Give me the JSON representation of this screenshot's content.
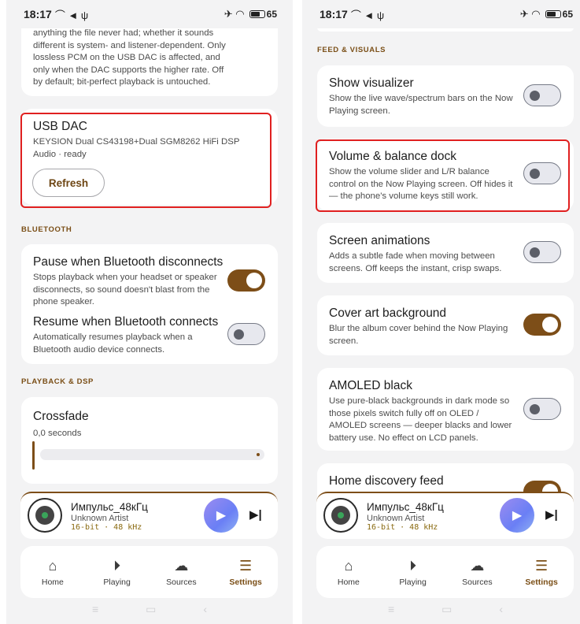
{
  "left": {
    "status": {
      "time": "18:17",
      "left_icons": "⌒ ◄ ψ",
      "right_icons": "✈ ◠",
      "battery": "65"
    },
    "top_card_text": "anything the file never had; whether it sounds different is system- and listener-dependent. Only lossless PCM on the USB DAC is affected, and only when the DAC supports the higher rate. Off by default; bit-perfect playback is untouched.",
    "usb_dac": {
      "title": "USB DAC",
      "desc": "KEYSION Dual CS43198+Dual SGM8262 HiFi DSP Audio · ready",
      "button": "Refresh"
    },
    "bluetooth_label": "BLUETOOTH",
    "bt_pause": {
      "title": "Pause when Bluetooth disconnects",
      "desc": "Stops playback when your headset or speaker disconnects, so sound doesn't blast from the phone speaker.",
      "on": true
    },
    "bt_resume": {
      "title": "Resume when Bluetooth connects",
      "desc": "Automatically resumes playback when a Bluetooth audio device connects.",
      "on": false
    },
    "playback_label": "PLAYBACK & DSP",
    "crossfade": {
      "title": "Crossfade",
      "value": "0,0 seconds"
    }
  },
  "right": {
    "status": {
      "time": "18:17",
      "left_icons": "⌒ ◄ ψ",
      "right_icons": "✈ ◠",
      "battery": "65"
    },
    "feed_label": "FEED & VISUALS",
    "visualizer": {
      "title": "Show visualizer",
      "desc": "Show the live wave/spectrum bars on the Now Playing screen.",
      "on": false
    },
    "volume_dock": {
      "title": "Volume & balance dock",
      "desc": "Show the volume slider and L/R balance control on the Now Playing screen. Off hides it — the phone's volume keys still work.",
      "on": false
    },
    "animations": {
      "title": "Screen animations",
      "desc": "Adds a subtle fade when moving between screens. Off keeps the instant, crisp swaps.",
      "on": false
    },
    "cover_bg": {
      "title": "Cover art background",
      "desc": "Blur the album cover behind the Now Playing screen.",
      "on": true
    },
    "amoled": {
      "title": "AMOLED black",
      "desc": "Use pure-black backgrounds in dark mode so those pixels switch fully off on OLED / AMOLED screens — deeper blacks and lower battery use. No effect on LCD panels.",
      "on": false
    },
    "home_feed": {
      "title": "Home discovery feed"
    }
  },
  "player": {
    "title": "Импульс_48кГц",
    "artist": "Unknown Artist",
    "quality": "16-bit · 48 kHz"
  },
  "nav": {
    "home": "Home",
    "playing": "Playing",
    "sources": "Sources",
    "settings": "Settings",
    "active": "settings"
  },
  "colors": {
    "accent": "#7d4e18",
    "highlight": "#e02020",
    "play_button": "#7f86f3"
  },
  "icons": {
    "home": "home-icon",
    "playing": "play-circle-icon",
    "sources": "cloud-icon",
    "settings": "sliders-icon"
  }
}
